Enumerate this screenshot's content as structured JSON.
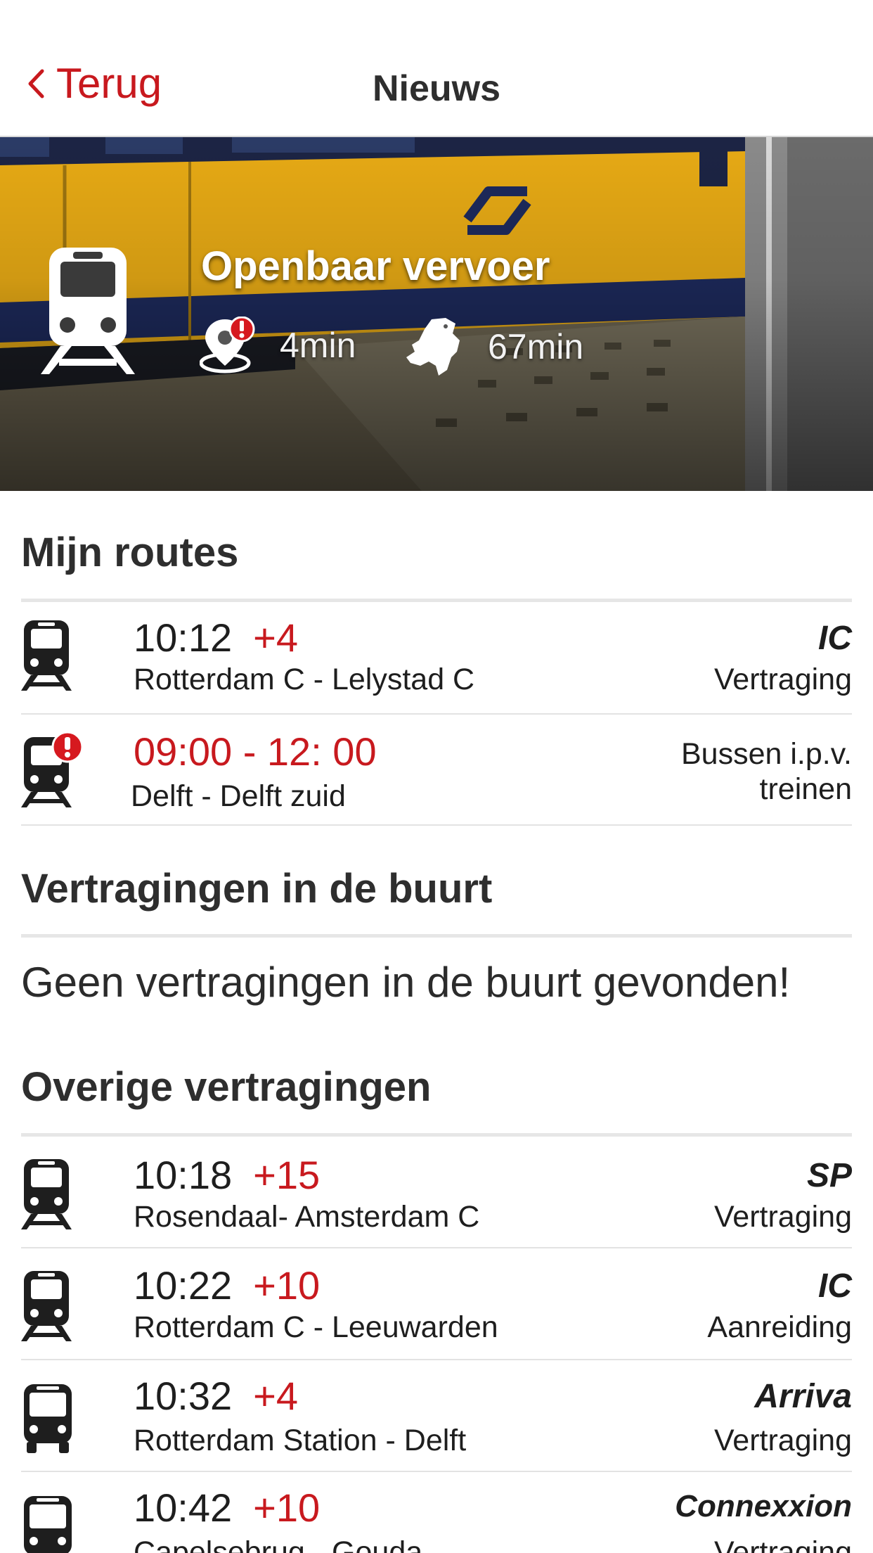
{
  "nav": {
    "back_label": "Terug",
    "title": "Nieuws"
  },
  "hero": {
    "title": "Openbaar vervoer",
    "local_stat": "4min",
    "national_stat": "67min",
    "icons": [
      "train-icon",
      "location-alert-icon",
      "netherlands-map-icon"
    ]
  },
  "my_routes": {
    "title": "Mijn routes",
    "items": [
      {
        "icon": "train-icon",
        "time": "10:12",
        "delay": "+4",
        "route": "Rotterdam C - Lelystad C",
        "operator": "IC",
        "status": "Vertraging"
      },
      {
        "icon": "train-alert-icon",
        "time_range": "09:00 - 12: 00",
        "route": "Delft - Delft zuid",
        "status_line1": "Bussen i.p.v.",
        "status_line2": "treinen"
      }
    ]
  },
  "nearby": {
    "title": "Vertragingen in de buurt",
    "empty_message": "Geen vertragingen in de buurt gevonden!"
  },
  "other": {
    "title": "Overige vertragingen",
    "items": [
      {
        "icon": "train-icon",
        "time": "10:18",
        "delay": "+15",
        "route": "Rosendaal- Amsterdam C",
        "operator": "SP",
        "status": "Vertraging"
      },
      {
        "icon": "train-icon",
        "time": "10:22",
        "delay": "+10",
        "route": "Rotterdam C - Leeuwarden",
        "operator": "IC",
        "status": "Aanreiding"
      },
      {
        "icon": "bus-icon",
        "time": "10:32",
        "delay": "+4",
        "route": "Rotterdam Station - Delft",
        "operator": "Arriva",
        "status": "Vertraging"
      },
      {
        "icon": "bus-icon",
        "time": "10:42",
        "delay": "+10",
        "route": "Capelsebrug - Gouda",
        "operator": "Connexxion",
        "status": "Vertraging"
      }
    ]
  },
  "colors": {
    "accent": "#c8191e",
    "text": "#1e1e1e",
    "divider": "#e3e3e3"
  }
}
